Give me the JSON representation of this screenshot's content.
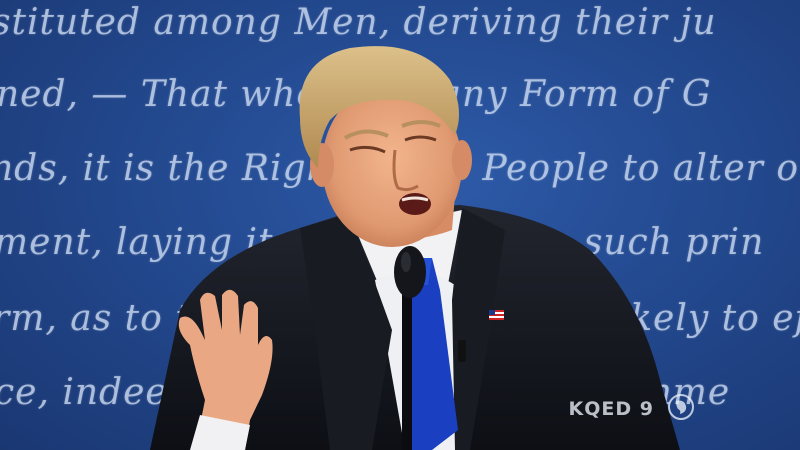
{
  "scene": {
    "backdrop_color": "#23498f",
    "backdrop_text_color": "#c8d7f0",
    "backdrop_lines": [
      "stituted among Men, deriving their ju",
      "ned, — That whenever any Form of G",
      "nds, it is the Right of the People to alter or",
      "ment, laying its foundation on such prin",
      "rm, as to them shall seem most likely to eff",
      "ce, indeed, will dictate that Governme"
    ],
    "suit_color": "#14161e",
    "tie_color": "#1a3fc0",
    "hair_color": "#c9a66a"
  },
  "watermark": {
    "channel_label": "KQED 9",
    "logo_icon": "pbs-head-icon"
  }
}
